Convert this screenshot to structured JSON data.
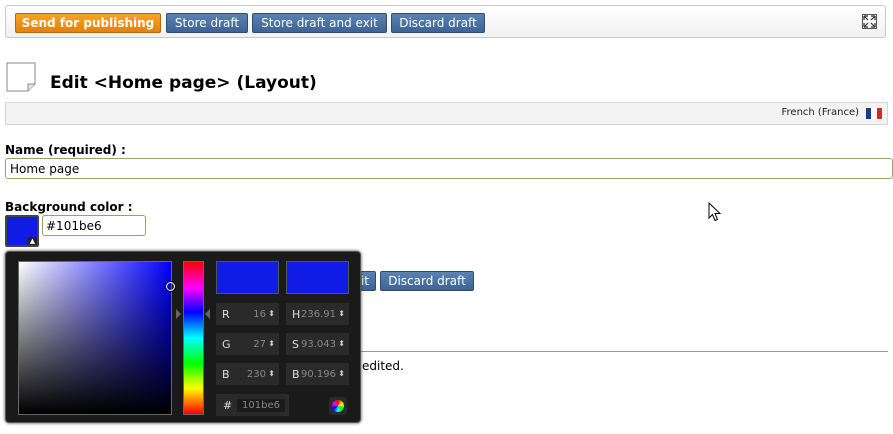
{
  "toolbar": {
    "publish_label": "Send for publishing",
    "store_draft_label": "Store draft",
    "store_exit_label": "Store draft and exit",
    "discard_label": "Discard draft",
    "expand_icon": "fullscreen-icon"
  },
  "header": {
    "title": "Edit <Home page> (Layout)",
    "icon": "document-icon"
  },
  "language": {
    "label": "French (France)",
    "flag_colors": [
      "#1c3a8f",
      "#ffffff",
      "#d62828"
    ]
  },
  "form": {
    "name_label": "Name (required) :",
    "name_value": "Home page",
    "bg_color_label": "Background color :",
    "bg_color_value": "#101be6",
    "bg_color_hex": "#101be6"
  },
  "bottom_bar": {
    "store_exit_partial": "it",
    "discard_label": "Discard draft"
  },
  "body_text": {
    "partial": "edited."
  },
  "color_picker": {
    "fields": {
      "r_label": "R",
      "r_value": "16",
      "g_label": "G",
      "g_value": "27",
      "b_label": "B",
      "b_value": "230",
      "h_label": "H",
      "h_value": "236.91",
      "s_label": "S",
      "s_value": "93.043",
      "v_label": "B",
      "v_value": "90.196"
    },
    "hex_label": "#",
    "hex_value": "101be6",
    "new_color": "#101be6",
    "current_color": "#101be6"
  }
}
